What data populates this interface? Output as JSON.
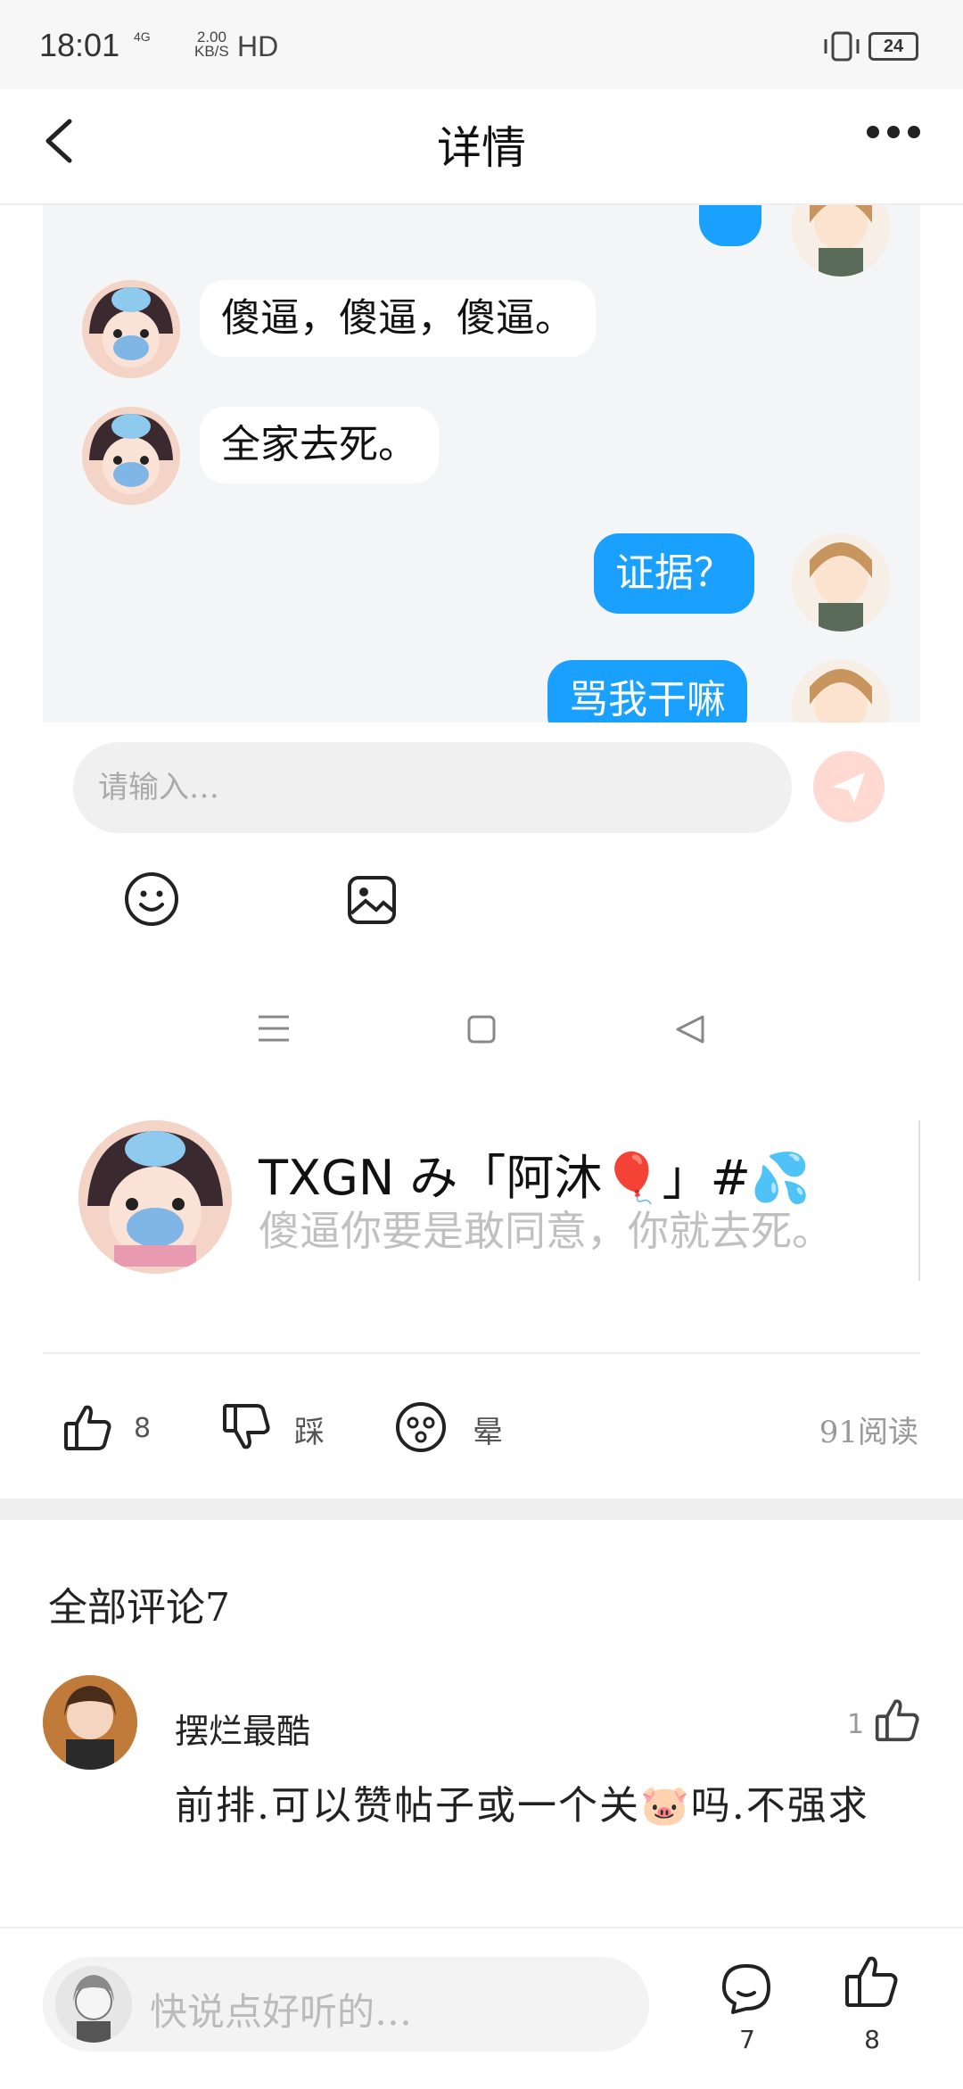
{
  "status": {
    "time": "18:01",
    "network": "4G",
    "speed_value": "2.00",
    "speed_unit": "KB/S",
    "hd": "HD",
    "battery": "24"
  },
  "header": {
    "title": "详情"
  },
  "chat": {
    "messages": [
      {
        "side": "left",
        "text": "傻逼，傻逼，傻逼。"
      },
      {
        "side": "left",
        "text": "全家去死。"
      },
      {
        "side": "right",
        "text": "证据？"
      },
      {
        "side": "right",
        "text": "骂我干嘛"
      }
    ],
    "input_placeholder": "请输入…"
  },
  "post": {
    "author_name": "TXGN み「阿沐🎈」#💦",
    "text": "傻逼你要是敢同意，你就去死。"
  },
  "actions": {
    "like_count": "8",
    "dislike_label": "踩",
    "dizzy_label": "晕",
    "reads": "91阅读"
  },
  "comments": {
    "title": "全部评论7",
    "items": [
      {
        "name": "摆烂最酷",
        "likes": "1",
        "text": "前排.可以赞帖子或一个关🐷吗.不强求"
      }
    ]
  },
  "bottom_bar": {
    "placeholder": "快说点好听的…",
    "comment_count": "7",
    "like_count": "8"
  },
  "colors": {
    "accent": "#1aa0ff",
    "send": "#ffd9d2"
  }
}
